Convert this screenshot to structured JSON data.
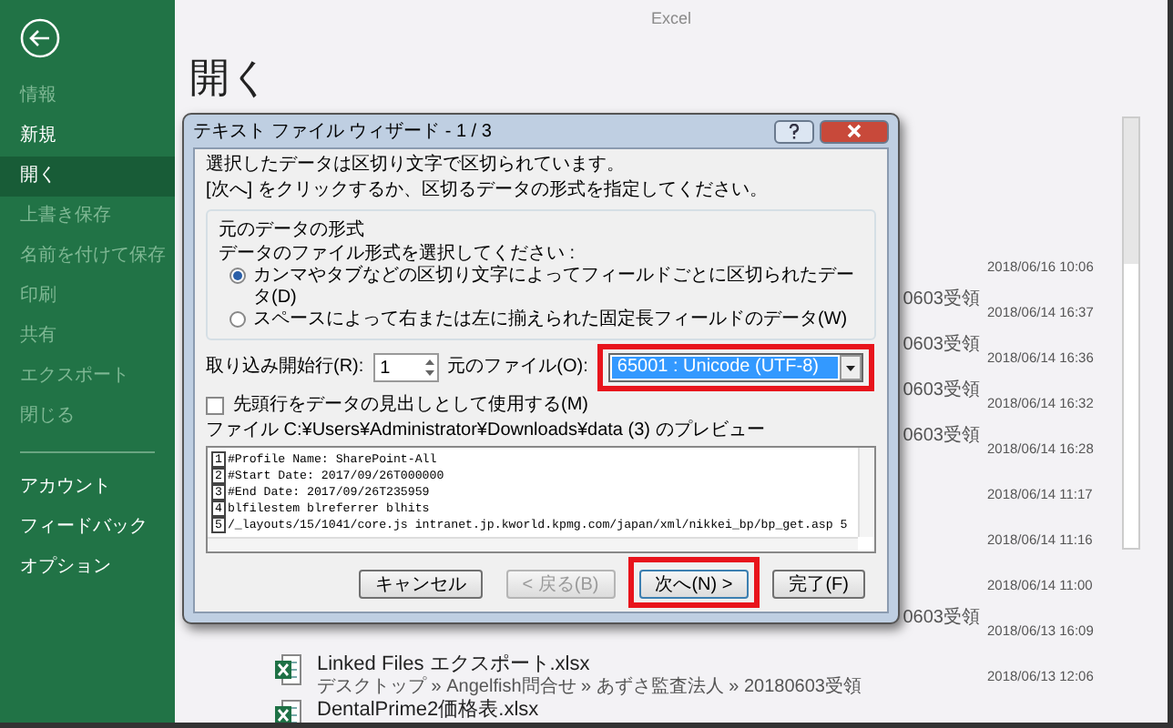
{
  "app": {
    "title": "Excel"
  },
  "sidebar": {
    "items": [
      {
        "label": "情報",
        "disabled": true,
        "selected": false
      },
      {
        "label": "新規",
        "disabled": false,
        "selected": false
      },
      {
        "label": "開く",
        "disabled": false,
        "selected": true
      },
      {
        "label": "上書き保存",
        "disabled": true,
        "selected": false
      },
      {
        "label": "名前を付けて保存",
        "disabled": true,
        "selected": false
      },
      {
        "label": "印刷",
        "disabled": true,
        "selected": false
      },
      {
        "label": "共有",
        "disabled": true,
        "selected": false
      },
      {
        "label": "エクスポート",
        "disabled": true,
        "selected": false
      },
      {
        "label": "閉じる",
        "disabled": true,
        "selected": false
      }
    ],
    "bottom_items": [
      {
        "label": "アカウント",
        "disabled": false,
        "selected": false
      },
      {
        "label": "フィードバック",
        "disabled": false,
        "selected": false
      },
      {
        "label": "オプション",
        "disabled": false,
        "selected": false
      }
    ]
  },
  "page": {
    "heading": "開く"
  },
  "files": [
    {
      "kind": "partial",
      "date": "2018/06/16 10:06"
    },
    {
      "kind": "partial",
      "path": "0603受領",
      "date": "2018/06/14 16:37"
    },
    {
      "kind": "partial",
      "path": "0603受領",
      "date": "2018/06/14 16:36"
    },
    {
      "kind": "partial",
      "path": "0603受領",
      "date": "2018/06/14 16:32"
    },
    {
      "kind": "partial",
      "path": "0603受領",
      "date": "2018/06/14 16:28"
    },
    {
      "kind": "partial",
      "date": "2018/06/14 11:17"
    },
    {
      "kind": "partial",
      "date": "2018/06/14 11:16"
    },
    {
      "kind": "partial",
      "date": "2018/06/14 11:00"
    },
    {
      "kind": "partial",
      "path": "0603受領",
      "date": "2018/06/13 16:09"
    },
    {
      "kind": "full",
      "name": "Linked Files エクスポート.xlsx",
      "path": "デスクトップ » Angelfish問合せ » あずさ監査法人 » 20180603受領",
      "date": "2018/06/13 12:06"
    },
    {
      "kind": "full",
      "name": "DentalPrime2価格表.xlsx"
    }
  ],
  "dialog": {
    "title": "テキスト ファイル ウィザード - 1 / 3",
    "intro": [
      "選択したデータは区切り文字で区切られています。",
      "[次へ] をクリックするか、区切るデータの形式を指定してください。"
    ],
    "group": {
      "legend": "元のデータの形式",
      "prompt": "データのファイル形式を選択してください :",
      "options": [
        {
          "label": "カンマやタブなどの区切り文字によってフィールドごとに区切られたデータ(D)",
          "selected": true
        },
        {
          "label": "スペースによって右または左に揃えられた固定長フィールドのデータ(W)",
          "selected": false
        }
      ]
    },
    "start_row": {
      "label": "取り込み開始行(R):",
      "value": "1"
    },
    "origin": {
      "label": "元のファイル(O):",
      "value": "65001 : Unicode (UTF-8)",
      "highlighted": true
    },
    "header_checkbox": {
      "label": "先頭行をデータの見出しとして使用する(M)",
      "checked": false
    },
    "preview": {
      "label": "ファイル C:¥Users¥Administrator¥Downloads¥data (3) のプレビュー",
      "lines": [
        {
          "number": "1",
          "text": "#Profile Name: SharePoint-All"
        },
        {
          "number": "2",
          "text": "#Start Date: 2017/09/26T000000"
        },
        {
          "number": "3",
          "text": "#End Date: 2017/09/26T235959"
        },
        {
          "number": "4",
          "text": "blfilestem blreferrer blhits"
        },
        {
          "number": "5",
          "text": "/_layouts/15/1041/core.js intranet.jp.kworld.kpmg.com/japan/xml/nikkei_bp/bp_get.asp 5"
        }
      ]
    },
    "buttons": [
      {
        "label": "キャンセル",
        "disabled": false,
        "highlighted": false
      },
      {
        "label": "< 戻る(B)",
        "disabled": true,
        "highlighted": false
      },
      {
        "label": "次へ(N) >",
        "disabled": false,
        "highlighted": true
      },
      {
        "label": "完了(F)",
        "disabled": false,
        "highlighted": false
      }
    ]
  }
}
